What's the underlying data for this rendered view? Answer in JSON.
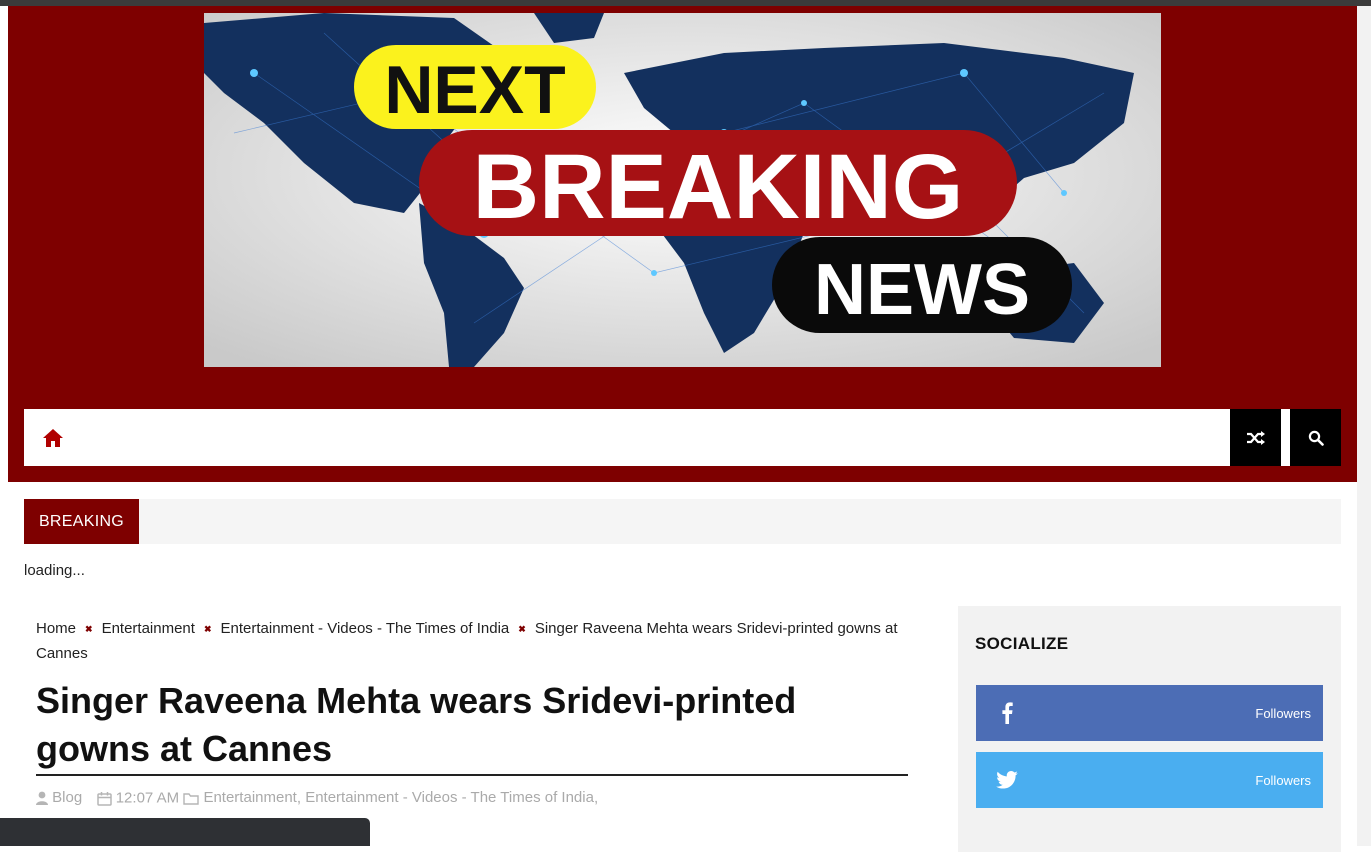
{
  "banner": {
    "line1": "NEXT",
    "line2": "BREAKING",
    "line3": "NEWS"
  },
  "nav": {
    "home_icon": "home-icon",
    "shuffle_icon": "shuffle-icon",
    "search_icon": "search-icon"
  },
  "ticker": {
    "label": "BREAKING",
    "status": "loading..."
  },
  "breadcrumb": {
    "items": [
      "Home",
      "Entertainment",
      "Entertainment - Videos - The Times of India",
      "Singer Raveena Mehta wears Sridevi-printed gowns at Cannes"
    ]
  },
  "article": {
    "title": "Singer Raveena Mehta wears Sridevi-printed gowns at Cannes",
    "author": "Blog",
    "time": "12:07 AM",
    "categories": [
      "Entertainment",
      "Entertainment - Videos - The Times of India"
    ]
  },
  "sidebar": {
    "heading": "SOCIALIZE",
    "facebook_label": "Followers",
    "twitter_label": "Followers"
  },
  "colors": {
    "brand": "#7e0000",
    "facebook": "#4c6db5",
    "twitter": "#4aaef0"
  }
}
